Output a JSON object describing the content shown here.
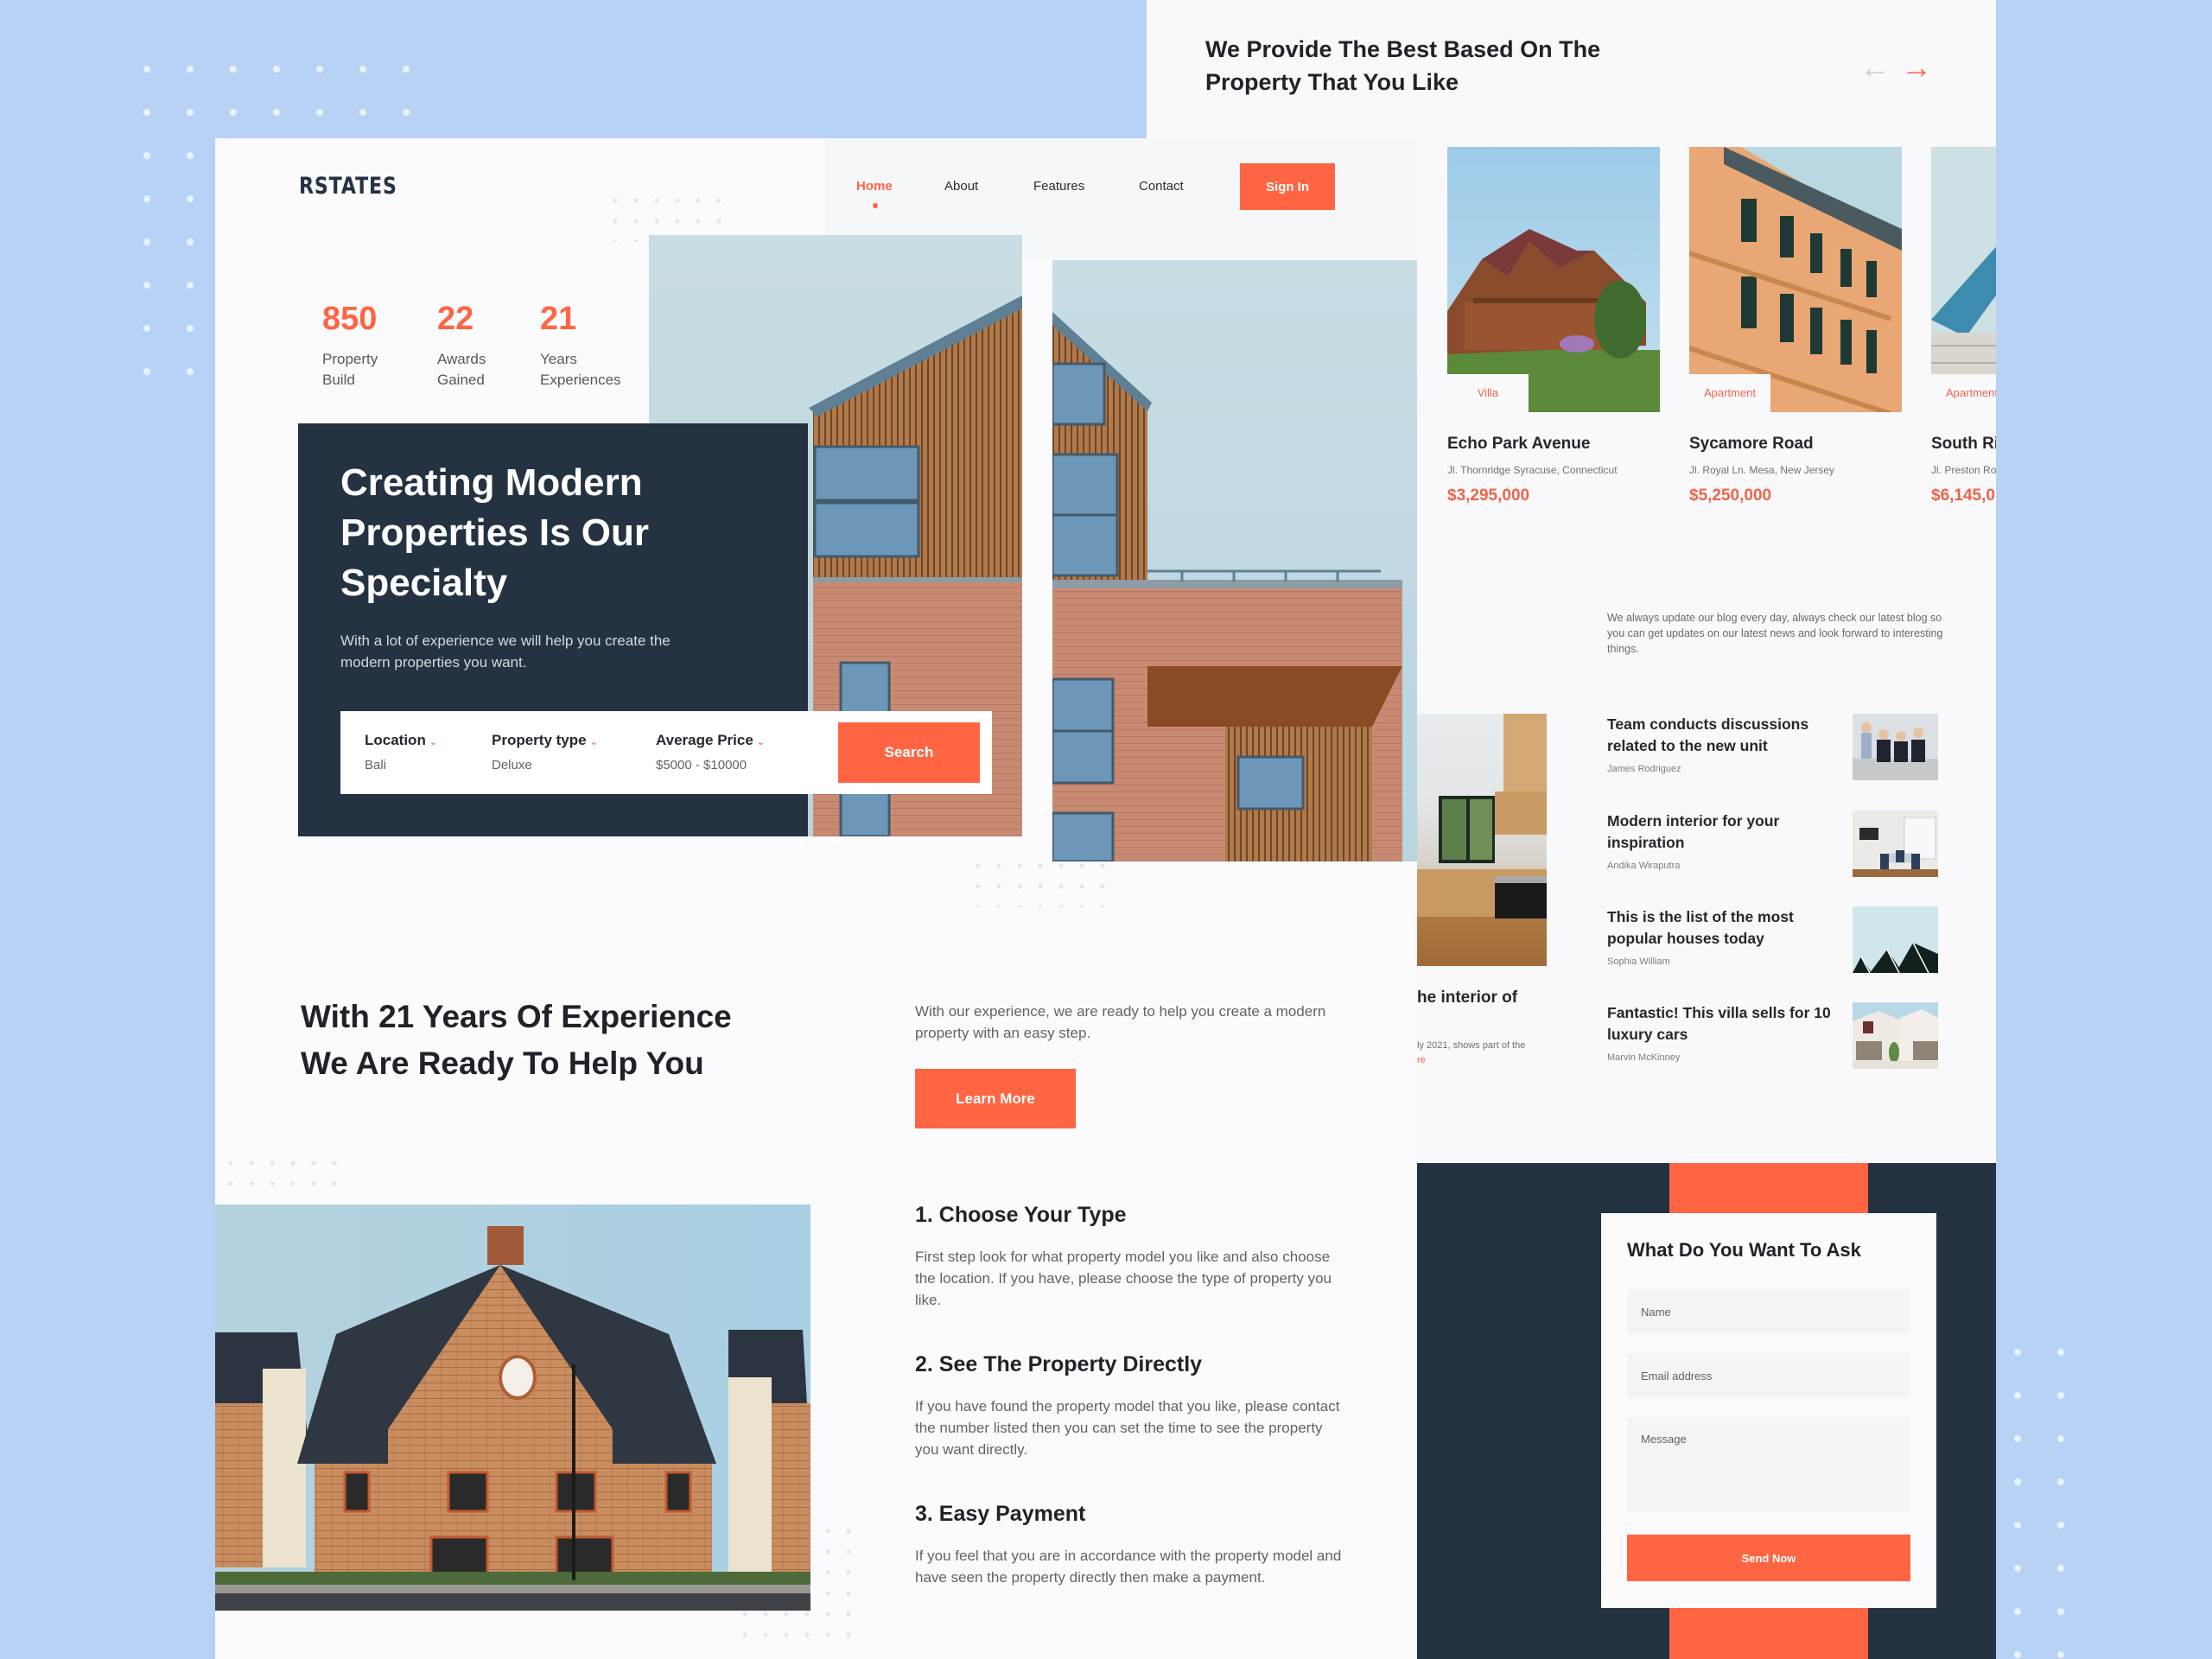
{
  "brand": {
    "logo": "RSTATES"
  },
  "nav": {
    "items": [
      {
        "label": "Home",
        "active": true
      },
      {
        "label": "About",
        "active": false
      },
      {
        "label": "Features",
        "active": false
      },
      {
        "label": "Contact",
        "active": false
      }
    ],
    "signin_label": "Sign In"
  },
  "stats": [
    {
      "value": "850",
      "label": "Property Build"
    },
    {
      "value": "22",
      "label": "Awards Gained"
    },
    {
      "value": "21",
      "label": "Years Experiences"
    }
  ],
  "hero": {
    "title": "Creating Modern Properties Is Our Specialty",
    "subtitle": "With a lot of experience we will help you create the modern properties you want."
  },
  "search": {
    "fields": [
      {
        "label": "Location",
        "value": "Bali"
      },
      {
        "label": "Property type",
        "value": "Deluxe"
      },
      {
        "label": "Average Price",
        "value": "$5000 - $10000"
      }
    ],
    "button_label": "Search"
  },
  "experience": {
    "title": "With 21 Years Of Experience We Are Ready To Help You",
    "subtitle": "With our experience, we are ready to help you create a modern property with an easy step.",
    "button_label": "Learn More"
  },
  "steps": [
    {
      "title": "1. Choose Your Type",
      "desc": "First step look for what property model you like and also choose the location. If you have, please choose the type of property you like."
    },
    {
      "title": "2. See The Property Directly",
      "desc": "If you have found the property model that you like, please contact the number listed then you can set the time to see the property you want directly."
    },
    {
      "title": "3. Easy Payment",
      "desc": "If you feel that you are in accordance with the property model and have seen the property directly then make a payment."
    }
  ],
  "properties": {
    "title": "We Provide The Best Based On The Property That You Like",
    "prev_icon": "arrow-left-icon",
    "next_icon": "arrow-right-icon",
    "items": [
      {
        "tag": "Villa",
        "name": "Echo Park Avenue",
        "address": "Jl. Thornridge Syracuse, Connecticut",
        "price": "$3,295,000"
      },
      {
        "tag": "Apartment",
        "name": "Sycamore Road",
        "address": "Jl. Royal Ln. Mesa, New Jersey",
        "price": "$5,250,000"
      },
      {
        "tag": "Apartment",
        "name": "South Ri",
        "address": "Jl. Preston Ro",
        "price": "$6,145,0"
      }
    ]
  },
  "blog": {
    "intro": "We always update our blog every day, always check our latest blog so you can get updates on our latest news and look forward to interesting things.",
    "featured_partial": {
      "title": "he interior of",
      "desc": "ly 2021, shows part of the",
      "link": "re"
    },
    "items": [
      {
        "title": "Team conducts discussions related to the new unit",
        "author": "James Rodriguez"
      },
      {
        "title": "Modern interior for your inspiration",
        "author": "Andika Wiraputra"
      },
      {
        "title": "This is the list of the most popular houses today",
        "author": "Sophia William"
      },
      {
        "title": "Fantastic! This villa sells for 10 luxury cars",
        "author": "Marvin McKinney"
      }
    ]
  },
  "contact": {
    "title": "What Do You Want To Ask",
    "name_placeholder": "Name",
    "email_placeholder": "Email address",
    "message_placeholder": "Message",
    "button_label": "Send Now"
  },
  "colors": {
    "accent": "#ff6542",
    "navy": "#243242",
    "background": "#b8d2f5"
  }
}
